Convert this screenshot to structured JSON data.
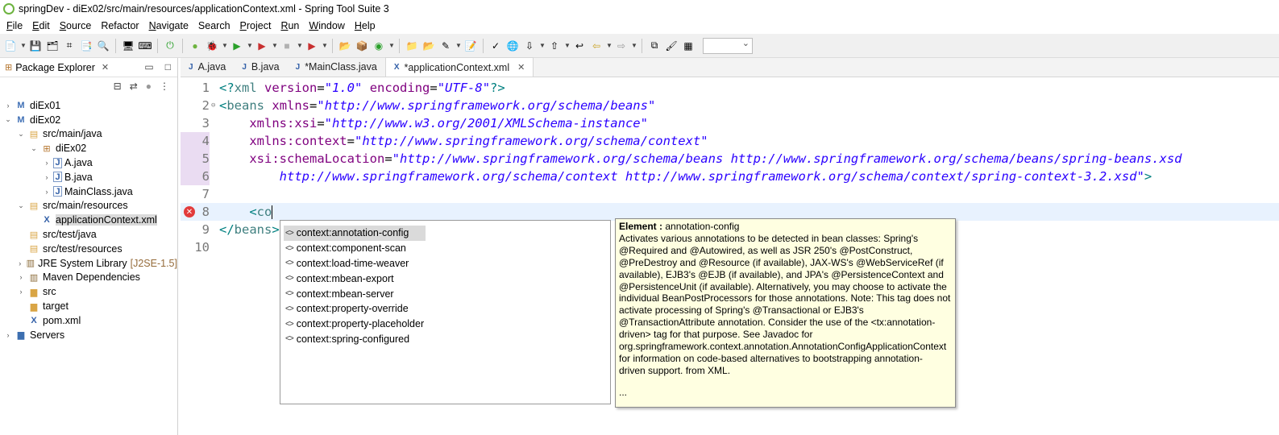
{
  "window": {
    "title": "springDev - diEx02/src/main/resources/applicationContext.xml - Spring Tool Suite 3"
  },
  "menu": [
    {
      "label": "File",
      "u": "F",
      "rest": "ile"
    },
    {
      "label": "Edit",
      "u": "E",
      "rest": "dit"
    },
    {
      "label": "Source",
      "u": "S",
      "rest": "ource"
    },
    {
      "label": "Refactor",
      "u": "",
      "rest": "Refactor"
    },
    {
      "label": "Navigate",
      "u": "N",
      "rest": "avigate"
    },
    {
      "label": "Search",
      "u": "",
      "rest": "Search"
    },
    {
      "label": "Project",
      "u": "P",
      "rest": "roject"
    },
    {
      "label": "Run",
      "u": "R",
      "rest": "un"
    },
    {
      "label": "Window",
      "u": "W",
      "rest": "indow"
    },
    {
      "label": "Help",
      "u": "H",
      "rest": "elp"
    }
  ],
  "package_explorer": {
    "tab_label": "Package Explorer",
    "tree": [
      {
        "label": "diEx01",
        "indent": 0,
        "arrow": "›",
        "icon": "project-icon"
      },
      {
        "label": "diEx02",
        "indent": 0,
        "arrow": "⌄",
        "icon": "project-icon"
      },
      {
        "label": "src/main/java",
        "indent": 1,
        "arrow": "⌄",
        "icon": "source-folder-icon"
      },
      {
        "label": "diEx02",
        "indent": 2,
        "arrow": "⌄",
        "icon": "package-icon"
      },
      {
        "label": "A.java",
        "indent": 3,
        "arrow": "›",
        "icon": "java-file-icon"
      },
      {
        "label": "B.java",
        "indent": 3,
        "arrow": "›",
        "icon": "java-file-icon"
      },
      {
        "label": "MainClass.java",
        "indent": 3,
        "arrow": "›",
        "icon": "java-file-icon"
      },
      {
        "label": "src/main/resources",
        "indent": 1,
        "arrow": "⌄",
        "icon": "source-folder-icon"
      },
      {
        "label": "applicationContext.xml",
        "indent": 2,
        "arrow": "",
        "icon": "xml-file-icon",
        "selected": true
      },
      {
        "label": "src/test/java",
        "indent": 1,
        "arrow": "",
        "icon": "source-folder-icon"
      },
      {
        "label": "src/test/resources",
        "indent": 1,
        "arrow": "",
        "icon": "source-folder-icon"
      },
      {
        "label": "JRE System Library",
        "suffix": "[J2SE-1.5]",
        "indent": 1,
        "arrow": "›",
        "icon": "library-icon"
      },
      {
        "label": "Maven Dependencies",
        "indent": 1,
        "arrow": "›",
        "icon": "library-icon"
      },
      {
        "label": "src",
        "indent": 1,
        "arrow": "›",
        "icon": "folder-icon"
      },
      {
        "label": "target",
        "indent": 1,
        "arrow": "",
        "icon": "folder-icon"
      },
      {
        "label": "pom.xml",
        "indent": 1,
        "arrow": "",
        "icon": "xml-file-icon"
      },
      {
        "label": "Servers",
        "indent": 0,
        "arrow": "›",
        "icon": "server-folder-icon"
      }
    ]
  },
  "editor_tabs": [
    {
      "label": "A.java",
      "active": false
    },
    {
      "label": "B.java",
      "active": false
    },
    {
      "label": "*MainClass.java",
      "active": false
    },
    {
      "label": "*applicationContext.xml",
      "active": true
    }
  ],
  "code_lines": [
    {
      "n": "1",
      "html": "<span class='c-punc'>&lt;?</span><span class='c-tag'>xml</span> <span class='c-attr'>version</span>=<span class='c-str'>\"1.0\"</span> <span class='c-attr'>encoding</span>=<span class='c-str'>\"UTF-8\"</span><span class='c-punc'>?&gt;</span>"
    },
    {
      "n": "2",
      "fold": "⊖",
      "html": "<span class='c-punc'>&lt;</span><span class='c-tag'>beans</span> <span class='c-attr'>xmlns</span>=<span class='c-str'>\"http://www.springframework.org/schema/beans\"</span>"
    },
    {
      "n": "3",
      "html": "    <span class='c-attr'>xmlns:xsi</span>=<span class='c-str'>\"http://www.w3.org/2001/XMLSchema-instance\"</span>"
    },
    {
      "n": "4",
      "html": "    <span class='c-attr'>xmlns:context</span>=<span class='c-str'>\"http://www.springframework.org/schema/context\"</span>"
    },
    {
      "n": "5",
      "html": "    <span class='c-attr'>xsi:schemaLocation</span>=<span class='c-str'>\"http://www.springframework.org/schema/beans http://www.springframework.org/schema/beans/spring-beans.xsd</span>"
    },
    {
      "n": "6",
      "html": "        <span class='c-str'>http://www.springframework.org/schema/context http://www.springframework.org/schema/context/spring-context-3.2.xsd\"</span><span class='c-punc'>&gt;</span>"
    },
    {
      "n": "7",
      "html": ""
    },
    {
      "n": "8",
      "html": "    <span class='c-punc'>&lt;</span><span class='c-tag'>co</span>",
      "current": true,
      "error": true
    },
    {
      "n": "9",
      "html": "<span class='c-punc'>&lt;/</span><span class='c-tag'>beans</span><span class='c-punc'>&gt;</span>"
    },
    {
      "n": "10",
      "html": ""
    }
  ],
  "content_assist": {
    "items": [
      "context:annotation-config",
      "context:component-scan",
      "context:load-time-weaver",
      "context:mbean-export",
      "context:mbean-server",
      "context:property-override",
      "context:property-placeholder",
      "context:spring-configured"
    ],
    "selected_index": 0
  },
  "javadoc": {
    "head_label": "Element :",
    "head_value": " annotation-config",
    "body": "Activates various annotations to be detected in bean classes: Spring's\n@Required and @Autowired, as well as JSR 250's @PostConstruct,\n@PreDestroy and @Resource (if available), JAX-WS's @WebServiceRef (if\navailable), EJB3's @EJB (if available), and JPA's @PersistenceContext and\n@PersistenceUnit (if available). Alternatively, you may choose to activate the\nindividual BeanPostProcessors for those annotations. Note: This tag does not\nactivate processing of Spring's @Transactional or EJB3's\n@TransactionAttribute annotation. Consider the use of the <tx:annotation-\ndriven> tag for that purpose. See Javadoc for\norg.springframework.context.annotation.AnnotationConfigApplicationContext\nfor information on code-based alternatives to bootstrapping annotation-\ndriven support. from XML.",
    "more": "..."
  }
}
